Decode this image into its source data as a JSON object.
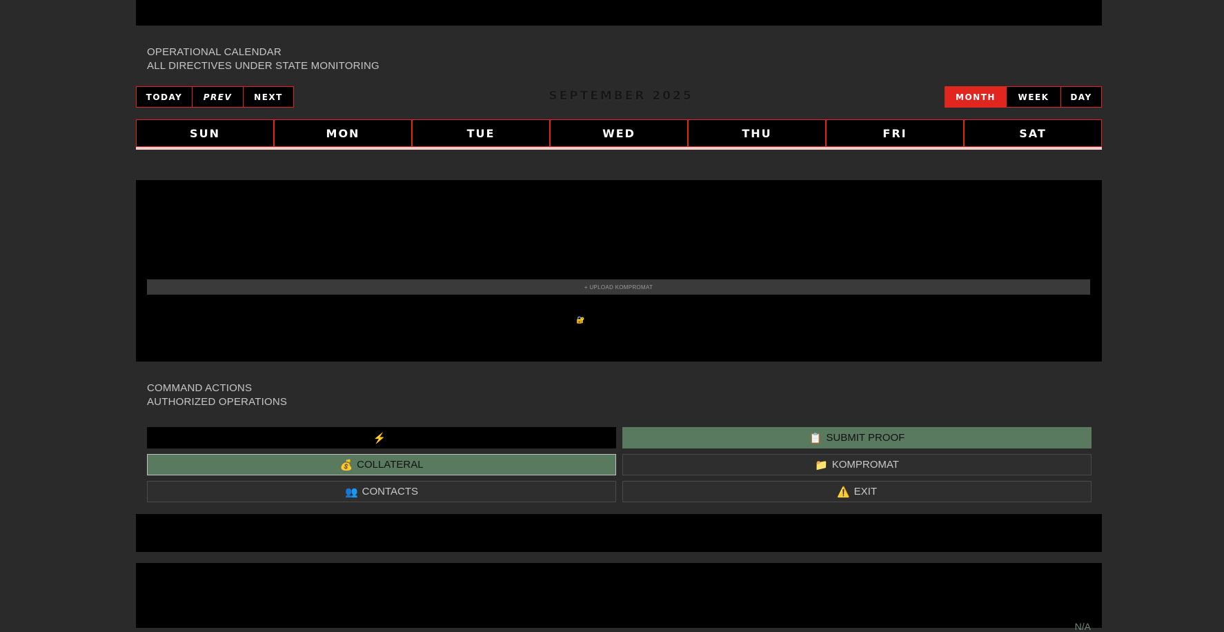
{
  "header": {
    "title": "OPERATIONAL CALENDAR",
    "subtitle": "ALL DIRECTIVES UNDER STATE MONITORING"
  },
  "nav": {
    "today": "TODAY",
    "prev": "PREV",
    "next": "NEXT"
  },
  "month_label": "SEPTEMBER 2025",
  "views": {
    "month": "MONTH",
    "week": "WEEK",
    "day": "DAY",
    "active": "month"
  },
  "weekdays": [
    "SUN",
    "MON",
    "TUE",
    "WED",
    "THU",
    "FRI",
    "SAT"
  ],
  "calendar": {
    "upload_label": "+ UPLOAD KOMPROMAT",
    "lock_icon": "lock-icon"
  },
  "commands": {
    "title": "COMMAND ACTIONS",
    "subtitle": "AUTHORIZED OPERATIONS",
    "items": [
      {
        "label": "",
        "icon": "lightning-icon",
        "glyph": "⚡",
        "style": "black"
      },
      {
        "label": "SUBMIT PROOF",
        "icon": "clipboard-icon",
        "glyph": "📋",
        "style": "green"
      },
      {
        "label": "COLLATERAL",
        "icon": "money-bag-icon",
        "glyph": "💰",
        "style": "green outl"
      },
      {
        "label": "KOMPROMAT",
        "icon": "folder-icon",
        "glyph": "📁",
        "style": "dark"
      },
      {
        "label": "CONTACTS",
        "icon": "contacts-icon",
        "glyph": "👥",
        "style": "dark"
      },
      {
        "label": "EXIT",
        "icon": "warning-icon",
        "glyph": "⚠️",
        "style": "dark"
      }
    ]
  },
  "footer": {
    "status": "N/A"
  },
  "colors": {
    "accent": "#e0261e",
    "green": "#5a7a60",
    "background": "#2a2a2a",
    "panel": "#000000"
  }
}
